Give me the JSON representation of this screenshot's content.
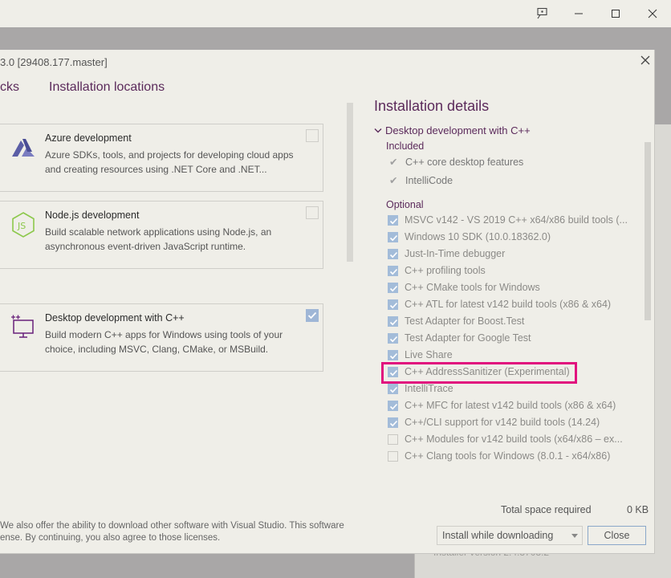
{
  "window": {
    "feedback_icon": "feedback-icon",
    "minimize_icon": "minimize-icon",
    "maximize_icon": "maximize-icon",
    "close_icon": "close-icon",
    "background_footer": "Installer version 2.4.3708.2"
  },
  "dialog": {
    "title": "3.0 [29408.177.master]",
    "tabs": [
      "cks",
      "Installation locations"
    ],
    "close_icon": "close-icon"
  },
  "workloads": [
    {
      "title": "Azure development",
      "description": "Azure SDKs, tools, and projects for developing cloud apps and creating resources using .NET Core and .NET...",
      "checked": false,
      "icon": "azure-icon",
      "accent": "#5b5ea6"
    },
    {
      "title": "Node.js development",
      "description": "Build scalable network applications using Node.js, an asynchronous event-driven JavaScript runtime.",
      "checked": false,
      "icon": "nodejs-icon",
      "accent": "#8cc84b"
    },
    {
      "title": "Desktop development with C++",
      "description": "Build modern C++ apps for Windows using tools of your choice, including MSVC, Clang, CMake, or MSBuild.",
      "checked": true,
      "icon": "desktop-cpp-icon",
      "accent": "#68217a"
    }
  ],
  "details": {
    "title": "Installation details",
    "workload": "Desktop development with C++",
    "included_label": "Included",
    "included": [
      "C++ core desktop features",
      "IntelliCode"
    ],
    "optional_label": "Optional",
    "optional": [
      {
        "label": "MSVC v142 - VS 2019 C++ x64/x86 build tools (...",
        "checked": true
      },
      {
        "label": "Windows 10 SDK (10.0.18362.0)",
        "checked": true
      },
      {
        "label": "Just-In-Time debugger",
        "checked": true
      },
      {
        "label": "C++ profiling tools",
        "checked": true
      },
      {
        "label": "C++ CMake tools for Windows",
        "checked": true
      },
      {
        "label": "C++ ATL for latest v142 build tools (x86 & x64)",
        "checked": true
      },
      {
        "label": "Test Adapter for Boost.Test",
        "checked": true
      },
      {
        "label": "Test Adapter for Google Test",
        "checked": true
      },
      {
        "label": "Live Share",
        "checked": true
      },
      {
        "label": "C++ AddressSanitizer (Experimental)",
        "checked": true
      },
      {
        "label": "IntelliTrace",
        "checked": true
      },
      {
        "label": "C++ MFC for latest v142 build tools (x86 & x64)",
        "checked": true
      },
      {
        "label": "C++/CLI support for v142 build tools (14.24)",
        "checked": true
      },
      {
        "label": "C++ Modules for v142 build tools (x64/x86 – ex...",
        "checked": false
      },
      {
        "label": "C++ Clang tools for Windows (8.0.1 - x64/x86)",
        "checked": false
      }
    ],
    "highlight_color": "#e1107e"
  },
  "footer": {
    "total_label": "Total space required",
    "total_value": "0 KB",
    "legal_line1": "We also offer the ability to download other software with Visual Studio. This software",
    "legal_line2": "ense. By continuing, you also agree to those licenses.",
    "install_mode": "Install while downloading",
    "close_label": "Close"
  }
}
